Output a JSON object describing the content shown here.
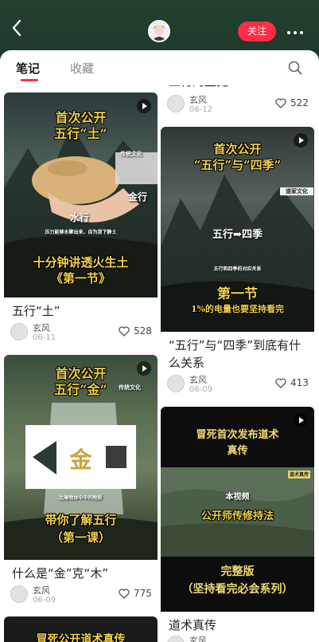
{
  "header": {
    "back_icon": "back-arrow-icon",
    "follow_label": "关注",
    "more_label": "···"
  },
  "tabs": [
    {
      "label": "笔记",
      "active": true
    },
    {
      "label": "收藏",
      "active": false
    }
  ],
  "notes": [
    {
      "id": "wuxing-tu",
      "cover_lines": [
        "首次公开",
        "五行“土”"
      ],
      "cover_tag": "传统文化",
      "cover_labels": [
        "金行",
        "水行"
      ],
      "cover_small": "压力能够水聚出来，自为我下静土",
      "cover_bottom": [
        "十分钟讲透火生土",
        "《第一节》"
      ],
      "title": "五行“土”",
      "author": "玄风",
      "date": "06-11",
      "likes": "528"
    },
    {
      "id": "wuxing-jin",
      "cover_lines": [
        "首次公开",
        "五行“金”"
      ],
      "cover_tag": "传统文化",
      "cover_center": "金",
      "cover_small": "比喻物体中中的物质",
      "cover_bottom": [
        "带你了解五行",
        "（第一课）"
      ],
      "title": "什么是“金”克“木”",
      "author": "玄风",
      "date": "06-09",
      "likes": "775"
    },
    {
      "id": "left-partial",
      "cover_lines": [
        "冒死公开道术真传"
      ]
    },
    {
      "id": "partial-top",
      "title_partial": "五行的生克",
      "author": "玄风",
      "date": "06-12",
      "likes": "522"
    },
    {
      "id": "wuxing-siji",
      "cover_lines": [
        "首次公开",
        "“五行”与“四季”"
      ],
      "cover_tag": "道家文化",
      "cover_mid": "五行➡四季",
      "cover_small": "五行和四季的对应关系",
      "cover_bottom": [
        "第一节",
        "1%的电量也要坚持看完"
      ],
      "title": "“五行”与“四季”到底有什么关系",
      "author": "玄风",
      "date": "06-09",
      "likes": "413"
    },
    {
      "id": "daoshu",
      "cover_lines": [
        "冒死首次发布道术",
        "真传"
      ],
      "cover_tag": "道术真传",
      "cover_mid": "本视频",
      "cover_mid2": "公开师传修持法",
      "cover_bottom": [
        "完整版",
        "（坚持看完必会系列）"
      ],
      "title": "道术真传",
      "author": "玄风"
    }
  ],
  "colors": {
    "accent": "#ff2c4a",
    "header_bg": "#1f3a2b",
    "caption_yellow": "#f3d24a"
  }
}
